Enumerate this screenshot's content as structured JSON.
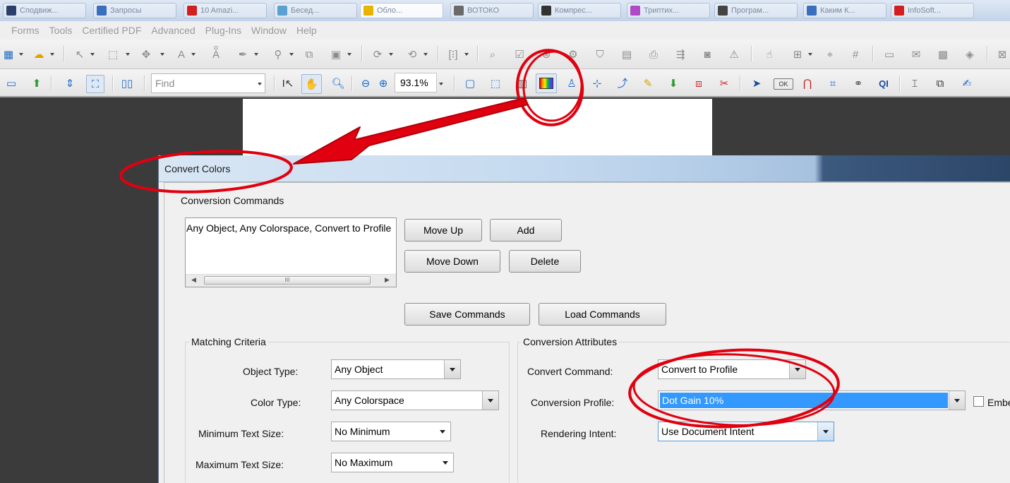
{
  "taskbar": {
    "tasks": [
      {
        "label": "Сподвиж...",
        "color": "#2a3f6a"
      },
      {
        "label": "Запросы",
        "color": "#3a6fc0"
      },
      {
        "label": "10 Amazi...",
        "color": "#d21e1e"
      },
      {
        "label": "Бесед...",
        "color": "#5aa0d0"
      },
      {
        "label": "Обло...",
        "color": "#e8b400"
      },
      {
        "label": "ВОТОКО",
        "color": "#6a6a6a"
      },
      {
        "label": "Компрес...",
        "color": "#333333"
      },
      {
        "label": "Триптих...",
        "color": "#b04ac8"
      },
      {
        "label": "Програм...",
        "color": "#444444"
      },
      {
        "label": "Каким К...",
        "color": "#3a6fc0"
      },
      {
        "label": "InfoSoft...",
        "color": "#d21e1e"
      }
    ]
  },
  "menubar": {
    "items": [
      "Forms",
      "Tools",
      "Certified PDF",
      "Advanced",
      "Plug-Ins",
      "Window",
      "Help"
    ]
  },
  "toolbar2": {
    "find_placeholder": "Find",
    "zoom": "93.1%"
  },
  "dialog": {
    "title": "Convert Colors",
    "conversion_commands": {
      "label": "Conversion Commands",
      "list_items": [
        "Any Object, Any Colorspace, Convert to Profile"
      ],
      "scroll_thumb": "III",
      "move_up": "Move Up",
      "add": "Add",
      "move_down": "Move Down",
      "delete": "Delete",
      "save_commands": "Save Commands",
      "load_commands": "Load Commands"
    },
    "matching_criteria": {
      "label": "Matching Criteria",
      "object_type_label": "Object Type:",
      "object_type_value": "Any Object",
      "color_type_label": "Color Type:",
      "color_type_value": "Any Colorspace",
      "min_text_label": "Minimum Text Size:",
      "min_text_value": "No Minimum",
      "max_text_label": "Maximum Text Size:",
      "max_text_value": "No Maximum"
    },
    "conversion_attributes": {
      "label": "Conversion Attributes",
      "convert_command_label": "Convert Command:",
      "convert_command_value": "Convert to Profile",
      "conversion_profile_label": "Conversion Profile:",
      "conversion_profile_value": "Dot Gain 10%",
      "rendering_intent_label": "Rendering Intent:",
      "rendering_intent_value": "Use Document Intent",
      "embed_label": "Embe"
    }
  },
  "colors": {
    "annotation": "#e0000f",
    "selection": "#3399ff"
  }
}
